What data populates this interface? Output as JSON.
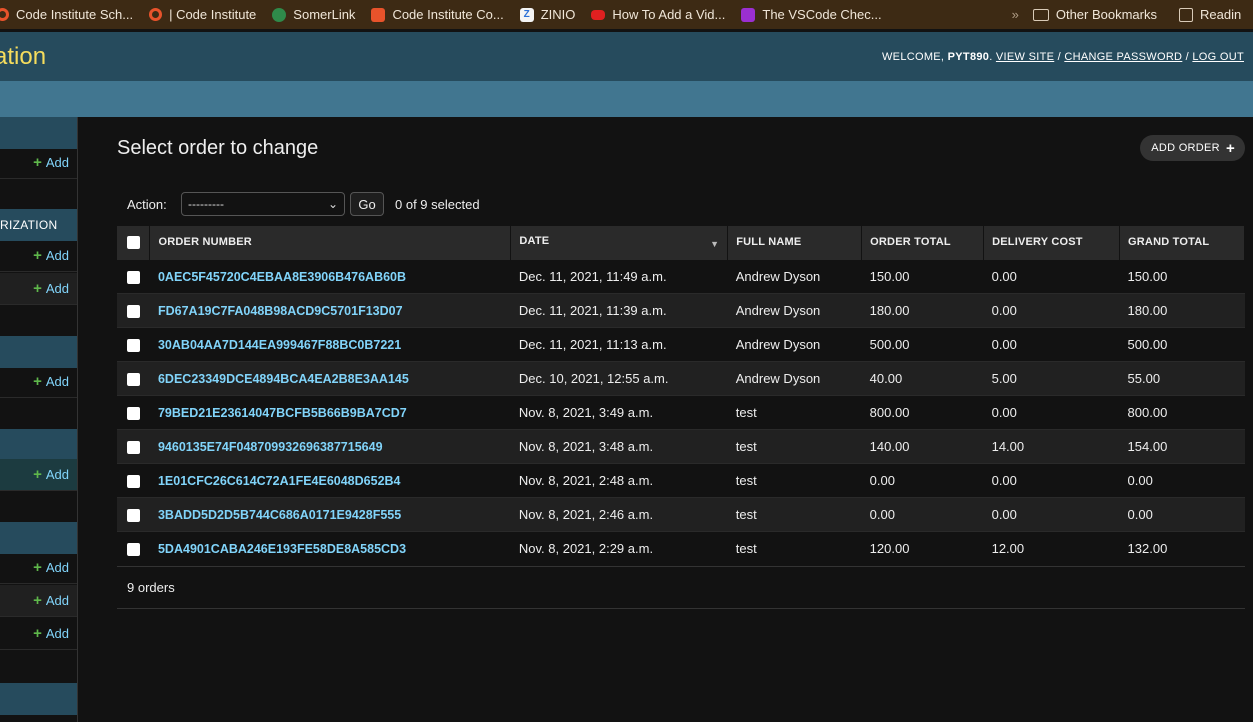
{
  "bookmarks": [
    {
      "label": "Code Institute Sch...",
      "icon": "ring-icon"
    },
    {
      "label": "| Code Institute",
      "icon": "ring-icon"
    },
    {
      "label": "SomerLink",
      "icon": "clover-icon"
    },
    {
      "label": "Code Institute Co...",
      "icon": "soundcloud-icon"
    },
    {
      "label": "ZINIO",
      "icon": "zinio-icon"
    },
    {
      "label": "How To Add a Vid...",
      "icon": "youtube-icon"
    },
    {
      "label": "The VSCode Chec...",
      "icon": "hashnode-icon"
    }
  ],
  "bookmarks_overflow": "»",
  "other_bookmarks": "Other Bookmarks",
  "reading_list": "Readin",
  "header": {
    "brand": "ation",
    "welcome": "WELCOME,",
    "username": "PYT890",
    "view_site": "VIEW SITE",
    "change_password": "CHANGE PASSWORD",
    "log_out": "LOG OUT",
    "sep": "/"
  },
  "sidebar": {
    "caption_authorization": "RIZATION",
    "add_label": "Add"
  },
  "page": {
    "title": "Select order to change",
    "add_button": "ADD ORDER",
    "action_label": "Action:",
    "action_value": "---------",
    "go_label": "Go",
    "selection_counter": "0 of 9 selected",
    "result_count": "9 orders"
  },
  "table": {
    "columns": [
      "ORDER NUMBER",
      "DATE",
      "FULL NAME",
      "ORDER TOTAL",
      "DELIVERY COST",
      "GRAND TOTAL"
    ],
    "rows": [
      [
        "0AEC5F45720C4EBAA8E3906B476AB60B",
        "Dec. 11, 2021, 11:49 a.m.",
        "Andrew Dyson",
        "150.00",
        "0.00",
        "150.00"
      ],
      [
        "FD67A19C7FA048B98ACD9C5701F13D07",
        "Dec. 11, 2021, 11:39 a.m.",
        "Andrew Dyson",
        "180.00",
        "0.00",
        "180.00"
      ],
      [
        "30AB04AA7D144EA999467F88BC0B7221",
        "Dec. 11, 2021, 11:13 a.m.",
        "Andrew Dyson",
        "500.00",
        "0.00",
        "500.00"
      ],
      [
        "6DEC23349DCE4894BCA4EA2B8E3AA145",
        "Dec. 10, 2021, 12:55 a.m.",
        "Andrew Dyson",
        "40.00",
        "5.00",
        "55.00"
      ],
      [
        "79BED21E23614047BCFB5B66B9BA7CD7",
        "Nov. 8, 2021, 3:49 a.m.",
        "test",
        "800.00",
        "0.00",
        "800.00"
      ],
      [
        "9460135E74F04870993269638771564 9",
        "Nov. 8, 2021, 3:48 a.m.",
        "test",
        "140.00",
        "14.00",
        "154.00"
      ],
      [
        "1E01CFC26C614C72A1FE4E6048D652B4",
        "Nov. 8, 2021, 2:48 a.m.",
        "test",
        "0.00",
        "0.00",
        "0.00"
      ],
      [
        "3BADD5D2D5B744C686A0171E9428F555",
        "Nov. 8, 2021, 2:46 a.m.",
        "test",
        "0.00",
        "0.00",
        "0.00"
      ],
      [
        "5DA4901CABA246E193FE58DE8A585CD3",
        "Nov. 8, 2021, 2:29 a.m.",
        "test",
        "120.00",
        "12.00",
        "132.00"
      ]
    ]
  }
}
